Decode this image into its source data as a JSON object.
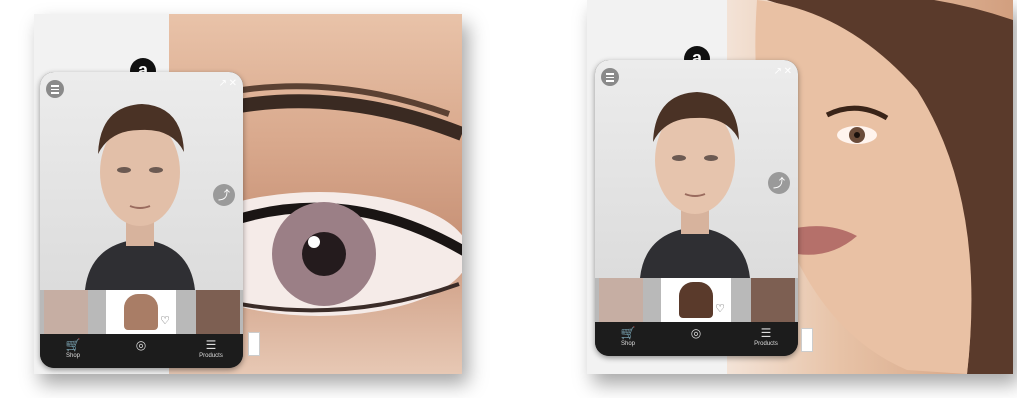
{
  "widget": {
    "logo_letter": "a"
  },
  "icons": {
    "menu": "menu-icon",
    "expand": "expand-icon",
    "close": "close-icon",
    "share": "share-icon",
    "heart": "heart-icon",
    "cart": "cart-icon",
    "scan": "scan-icon",
    "sliders": "sliders-icon"
  },
  "glyphs": {
    "expand": "↗",
    "close": "✕",
    "share": "⤴",
    "heart": "♡",
    "cart": "🛒",
    "scan": "◎",
    "sliders": "☰"
  },
  "cards": [
    {
      "photo": "eye-closeup-with-eyeliner",
      "nav": {
        "shop_label": "Shop",
        "center_label": "",
        "products_label": "Products"
      }
    },
    {
      "photo": "woman-face-makeup",
      "nav": {
        "shop_label": "Shop",
        "center_label": "",
        "products_label": "Products"
      }
    }
  ],
  "colors": {
    "phone_bar": "#1c1c1c",
    "logo_bg": "#111111"
  }
}
